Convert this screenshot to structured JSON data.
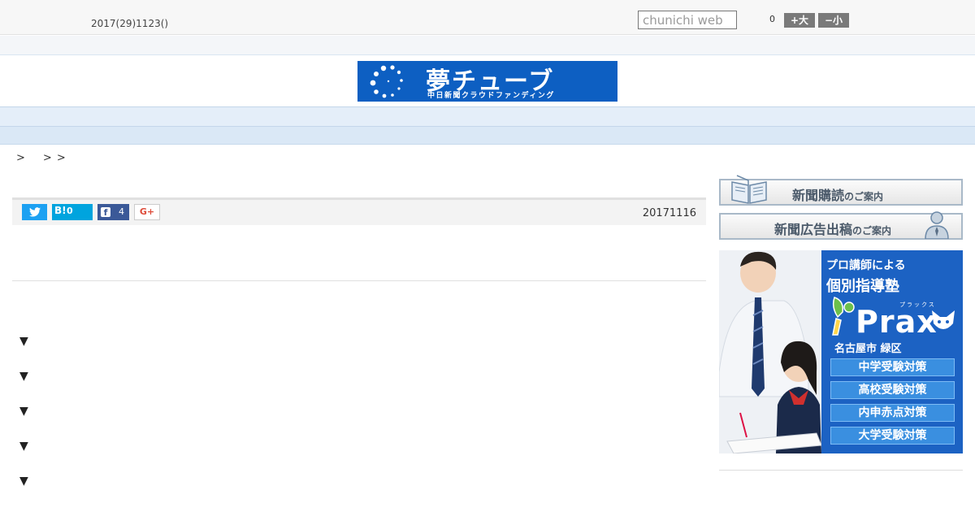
{
  "header": {
    "date": "2017(29)1123()",
    "search_placeholder": "chunichi web",
    "font_size_count": "0",
    "font_big_label": "+大",
    "font_small_label": "−小"
  },
  "logo": {
    "title": "夢チューブ",
    "subtitle": "中日新聞クラウドファンディング",
    "bg_color": "#0d5fc2"
  },
  "nav": {
    "items": [
      "",
      "",
      "",
      "",
      "",
      "",
      "",
      "",
      ""
    ]
  },
  "breadcrumb": [
    ">",
    ">",
    ">"
  ],
  "article": {
    "date": "20171116",
    "share": {
      "twitter_icon": "twitter-icon",
      "hatena_label": "B!",
      "hatena_count": "0",
      "facebook_icon": "f",
      "facebook_count": "4",
      "gplus_label": "G+"
    },
    "list_markers": [
      "▼",
      "▼",
      "▼",
      "▼",
      "▼"
    ]
  },
  "sidebar": {
    "subscribe_main": "新聞購読",
    "subscribe_suffix": "のご案内",
    "ads_main": "新聞広告出稿",
    "ads_suffix": "のご案内",
    "ad": {
      "headline1": "プロ講師による",
      "headline2": "個別指導塾",
      "brand": "Prax",
      "brand_ruby": "プラックス",
      "location": "名古屋市 緑区",
      "items": [
        "中学受験対策",
        "高校受験対策",
        "内申赤点対策",
        "大学受験対策"
      ]
    }
  },
  "colors": {
    "nav_bg": "#e4eef9",
    "twitter": "#1da1f2",
    "hatena": "#00a4de",
    "facebook": "#3b5998",
    "ad_blue": "#1c62c3"
  }
}
